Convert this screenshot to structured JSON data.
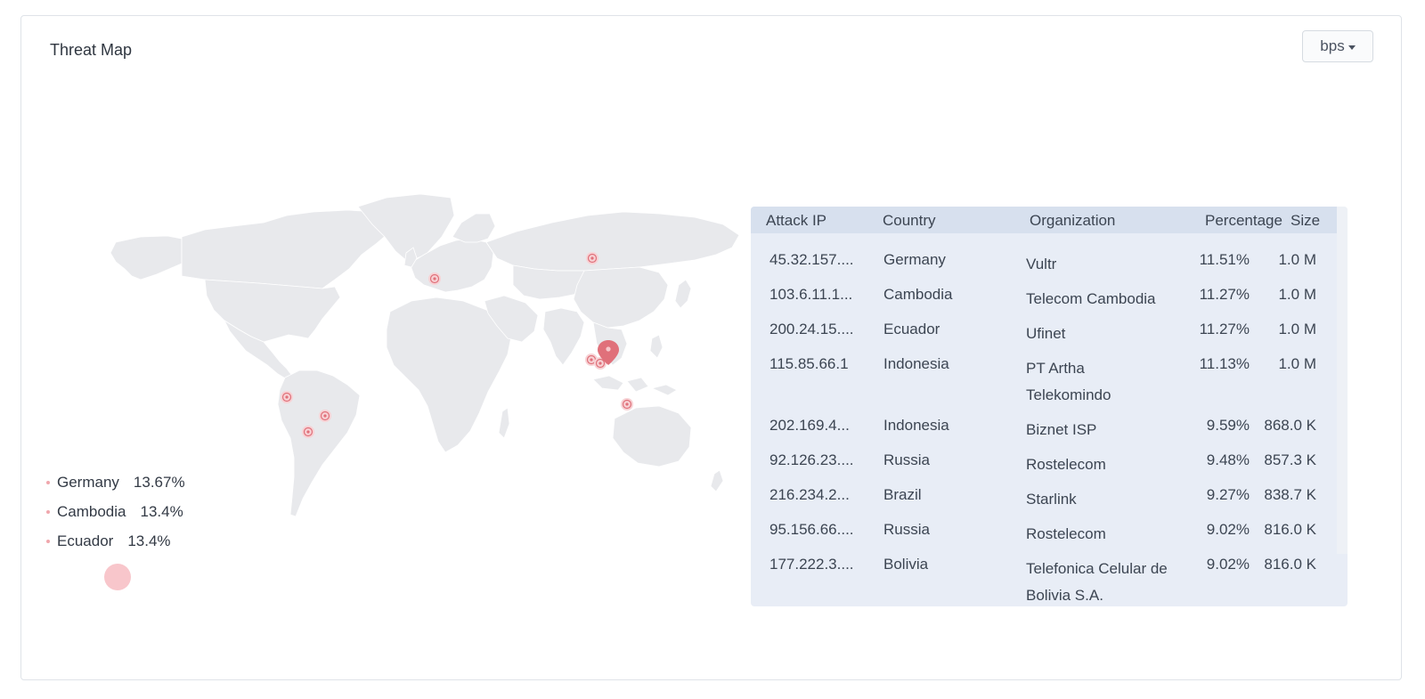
{
  "card": {
    "title": "Threat Map",
    "unit_selector": "bps"
  },
  "legend": {
    "items": [
      {
        "country": "Germany",
        "pct": "13.67%"
      },
      {
        "country": "Cambodia",
        "pct": "13.4%"
      },
      {
        "country": "Ecuador",
        "pct": "13.4%"
      }
    ]
  },
  "table": {
    "headers": {
      "ip": "Attack IP",
      "country": "Country",
      "org": "Organization",
      "pct": "Percentage",
      "size": "Size"
    },
    "rows": [
      {
        "ip": "45.32.157....",
        "country": "Germany",
        "org": "Vultr",
        "pct": "11.51%",
        "size": "1.0 M"
      },
      {
        "ip": "103.6.11.1...",
        "country": "Cambodia",
        "org": "Telecom Cambodia",
        "pct": "11.27%",
        "size": "1.0 M"
      },
      {
        "ip": "200.24.15....",
        "country": "Ecuador",
        "org": "Ufinet",
        "pct": "11.27%",
        "size": "1.0 M"
      },
      {
        "ip": "115.85.66.1",
        "country": "Indonesia",
        "org": "PT Artha Telekomindo",
        "pct": "11.13%",
        "size": "1.0 M"
      },
      {
        "ip": "202.169.4...",
        "country": "Indonesia",
        "org": "Biznet ISP",
        "pct": "9.59%",
        "size": "868.0 K"
      },
      {
        "ip": "92.126.23....",
        "country": "Russia",
        "org": "Rostelecom",
        "pct": "9.48%",
        "size": "857.3 K"
      },
      {
        "ip": "216.234.2...",
        "country": "Brazil",
        "org": "Starlink",
        "pct": "9.27%",
        "size": "838.7 K"
      },
      {
        "ip": "95.156.66....",
        "country": "Russia",
        "org": "Rostelecom",
        "pct": "9.02%",
        "size": "816.0 K"
      },
      {
        "ip": "177.222.3....",
        "country": "Bolivia",
        "org": "Telefonica Celular de Bolivia S.A.",
        "pct": "9.02%",
        "size": "816.0 K"
      }
    ]
  },
  "colors": {
    "land": "#e8e9ec",
    "marker": "#e0707a",
    "marker_ring": "#f3b8bd",
    "table_bg": "#e8edf6",
    "table_head_bg": "#d7e0ee"
  },
  "icons": {
    "unit_dropdown": "caret-down-icon",
    "selected_marker": "map-pin-icon"
  }
}
